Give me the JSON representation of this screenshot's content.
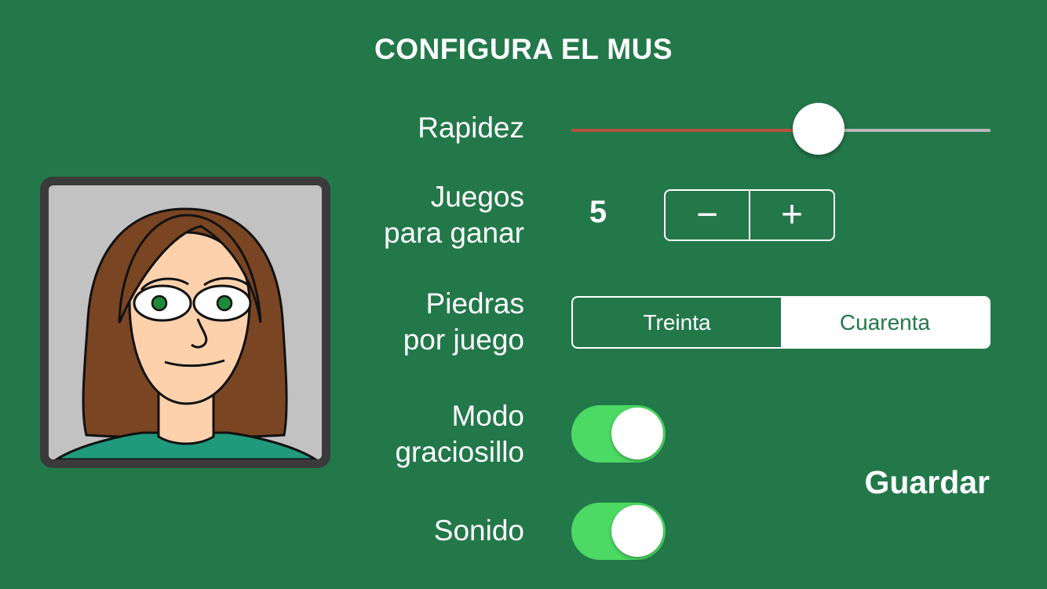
{
  "title": "CONFIGURA EL MUS",
  "settings": {
    "speed": {
      "label": "Rapidez",
      "value_fraction": 0.59
    },
    "games_to_win": {
      "label_line1": "Juegos",
      "label_line2": "para ganar",
      "value": "5",
      "decrement": "−",
      "increment": "+"
    },
    "stones_per_game": {
      "label_line1": "Piedras",
      "label_line2": "por juego",
      "options": [
        "Treinta",
        "Cuarenta"
      ],
      "selected_index": 1
    },
    "funny_mode": {
      "label_line1": "Modo",
      "label_line2": "graciosillo",
      "on": true
    },
    "sound": {
      "label": "Sonido",
      "on": true
    }
  },
  "save_label": "Guardar",
  "colors": {
    "background": "#23784a",
    "slider_filled": "#b5533d",
    "slider_empty": "#b8b8b8",
    "toggle_on": "#4cd964"
  },
  "avatar": {
    "icon": "woman-avatar-icon"
  }
}
